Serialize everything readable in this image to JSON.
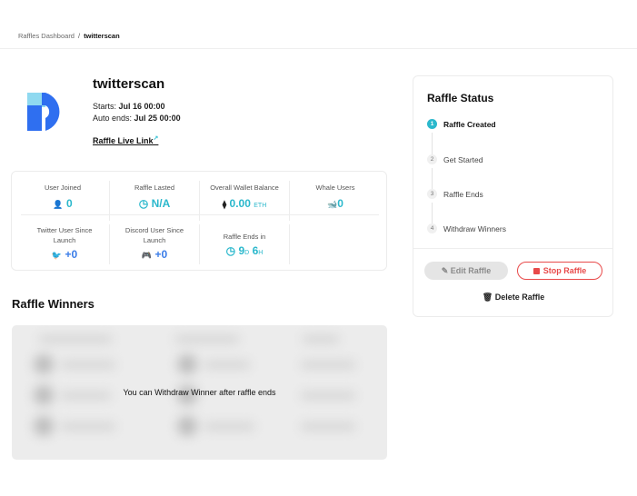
{
  "breadcrumb": {
    "parent": "Raffles Dashboard",
    "separator": "/",
    "current": "twitterscan"
  },
  "raffle": {
    "title": "twitterscan",
    "starts_label": "Starts:",
    "starts_value": "Jul 16 00:00",
    "ends_label": "Auto ends:",
    "ends_value": "Jul 25 00:00",
    "live_link": "Raffle Live Link",
    "live_link_icon": "↗"
  },
  "stats": {
    "user_joined": {
      "label": "User Joined",
      "icon": "👤",
      "value": "0"
    },
    "raffle_lasted": {
      "label": "Raffle Lasted",
      "icon": "◷",
      "value": "N/A"
    },
    "wallet_balance": {
      "label": "Overall Wallet Balance",
      "icon": "⧫",
      "value": "0.00",
      "unit": "ETH"
    },
    "whale_users": {
      "label": "Whale Users",
      "icon": "🐋",
      "value": "0"
    },
    "twitter_since": {
      "label": "Twitter User Since Launch",
      "icon": "🐦",
      "value": "+0"
    },
    "discord_since": {
      "label": "Discord User Since Launch",
      "icon": "🎮",
      "value": "+0"
    },
    "ends_in": {
      "label": "Raffle Ends in",
      "icon": "◷",
      "days": "9",
      "d_unit": "D",
      "hours": "6",
      "h_unit": "H"
    }
  },
  "winners": {
    "title": "Raffle Winners",
    "message": "You can Withdraw Winner after raffle ends"
  },
  "status": {
    "title": "Raffle Status",
    "steps": [
      {
        "num": "1",
        "label": "Raffle Created"
      },
      {
        "num": "2",
        "label": "Get Started"
      },
      {
        "num": "3",
        "label": "Raffle Ends"
      },
      {
        "num": "4",
        "label": "Withdraw Winners"
      }
    ],
    "active_step": 1,
    "edit_label": "Edit Raffle",
    "stop_label": "Stop Raffle",
    "delete_label": "Delete Raffle"
  },
  "colors": {
    "accent": "#2bb8cc",
    "danger": "#e84a4a",
    "link_blue": "#3b7de8"
  }
}
